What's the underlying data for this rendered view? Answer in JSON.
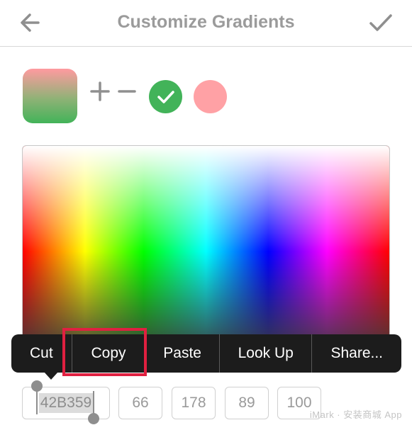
{
  "nav": {
    "title": "Customize Gradients",
    "back_icon": "arrow-left-icon",
    "done_icon": "checkmark-icon"
  },
  "gradient": {
    "stops": [
      {
        "color": "#ffa1a5",
        "selected": false
      },
      {
        "color": "#42b359",
        "selected": true
      }
    ],
    "add_icon": "plus-icon",
    "remove_icon": "minus-icon"
  },
  "context_menu": {
    "items": [
      "Cut",
      "Copy",
      "Paste",
      "Look Up",
      "Share..."
    ],
    "highlighted": "Copy",
    "highlight_color": "#e02040"
  },
  "fields": {
    "hex": "42B359",
    "r": "66",
    "g": "178",
    "b": "89",
    "a": "100"
  },
  "watermark": "iMark · 安装商城 App"
}
